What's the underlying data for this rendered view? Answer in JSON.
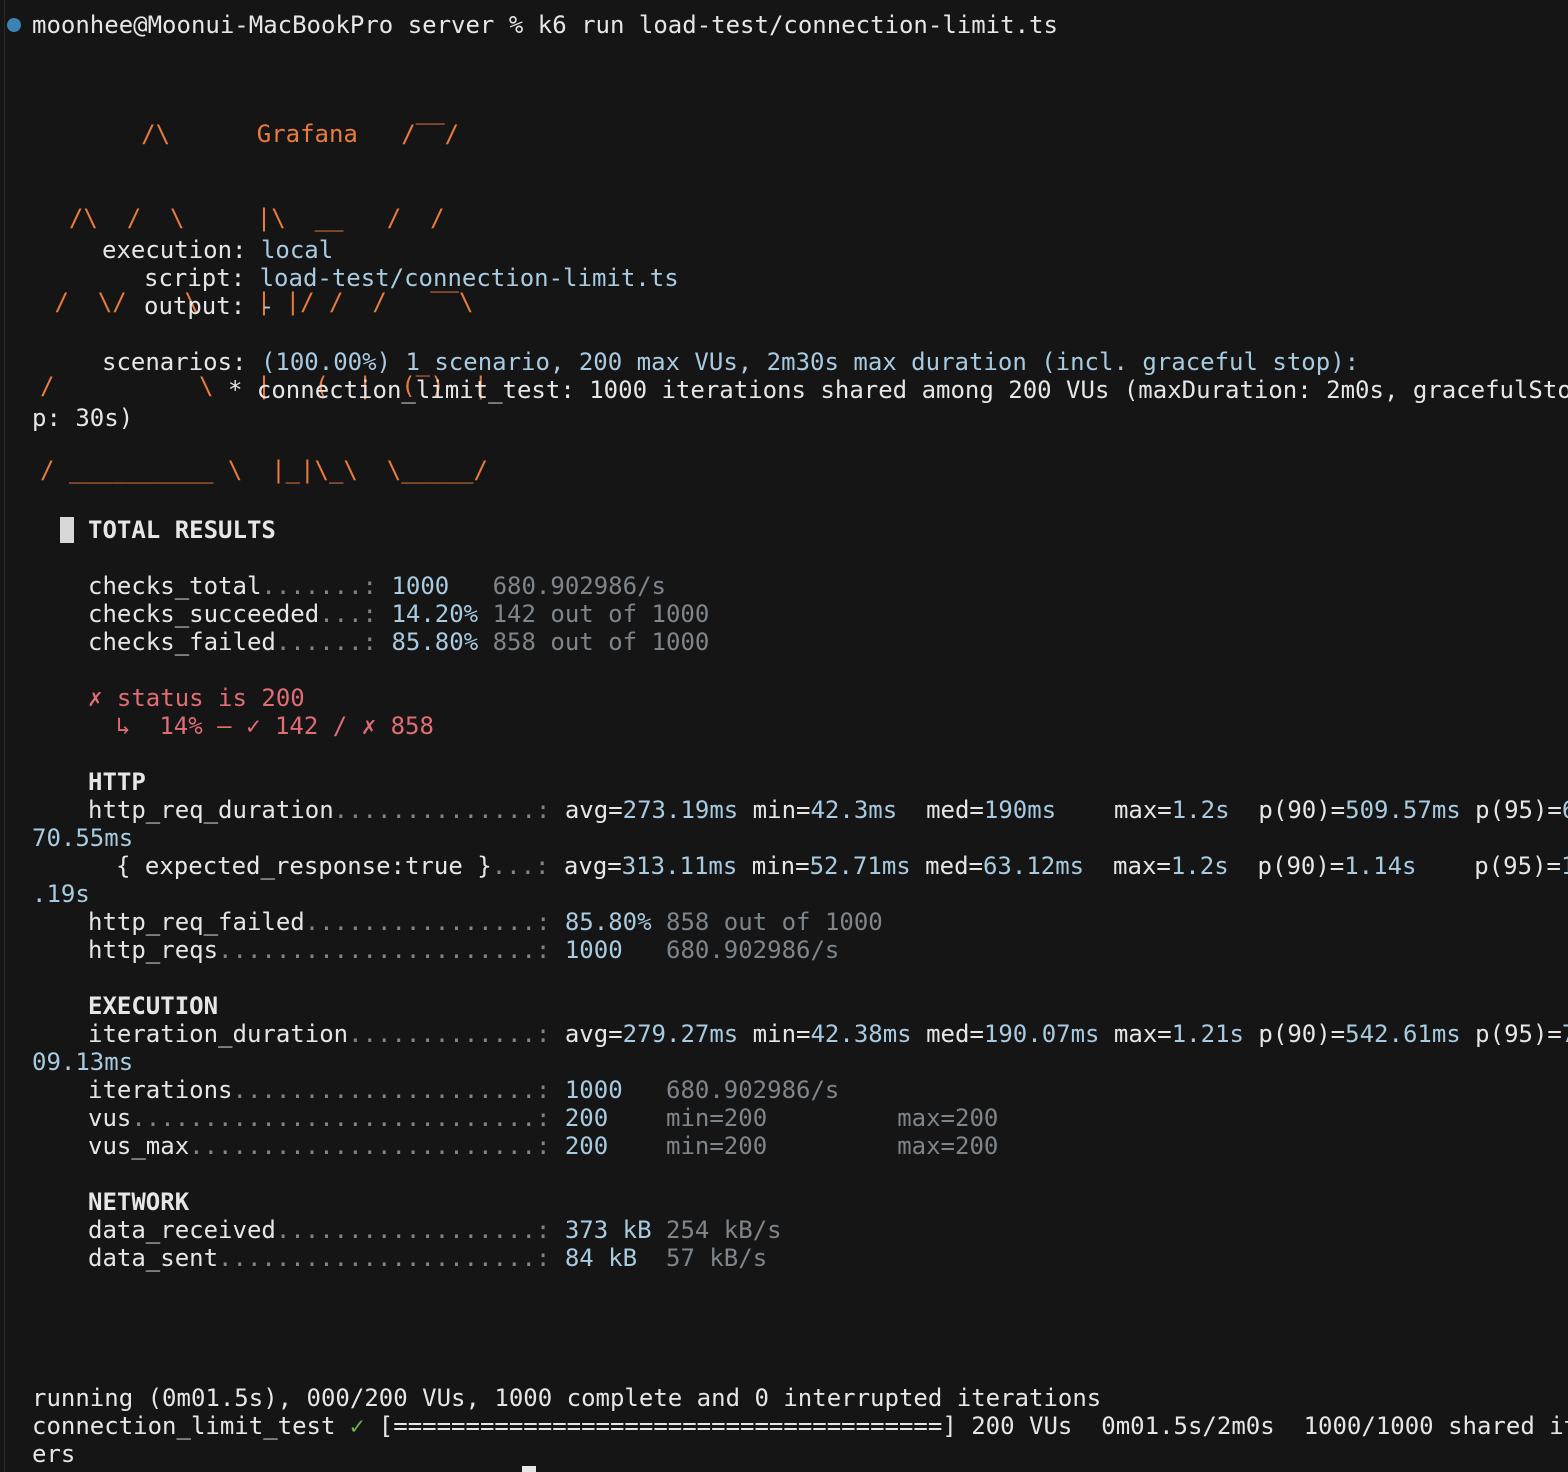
{
  "prompt": {
    "user": "moonhee@Moonui-MacBookPro",
    "dir": "server",
    "symbol": "%",
    "command": "k6 run load-test/connection-limit.ts"
  },
  "logo_art": [
    "       /\\      Grafana   /‾‾/",
    "  /\\  /  \\     |\\  __   /  /",
    " /  \\/    \\    | |/ /  /   ‾‾\\",
    "/          \\   |   (  |  (‾)  |",
    "/ __________ \\  |_|\\_\\  \\_____/"
  ],
  "execution": {
    "execution_label": "execution:",
    "execution_value": "local",
    "script_label": "script:",
    "script_value": "load-test/connection-limit.ts",
    "output_label": "output:",
    "output_value": "-",
    "scenarios_label": "scenarios:",
    "scenarios_value": "(100.00%) 1 scenario, 200 max VUs, 2m30s max duration (incl. graceful stop):",
    "scenario_line1": "* connection_limit_test: 1000 iterations shared among 200 VUs (maxDuration: 2m0s, gracefulSto",
    "scenario_line2": "p: 30s)"
  },
  "total_results": {
    "title": "TOTAL RESULTS"
  },
  "checks": [
    {
      "name": "checks_total",
      "dots": ".......:",
      "value": "1000",
      "extra": "   680.902986/s"
    },
    {
      "name": "checks_succeeded",
      "dots": "...:",
      "value": "14.20%",
      "extra": " 142 out of 1000"
    },
    {
      "name": "checks_failed",
      "dots": "......:",
      "value": "85.80%",
      "extra": " 858 out of 1000"
    }
  ],
  "status_check": {
    "line1": "✗ status is 200",
    "arrow": "↳",
    "pct": "14%",
    "sep": "—",
    "ok": "✓ 142",
    "slash": "/",
    "fail": "✗ 858"
  },
  "http": {
    "title": "HTTP",
    "req_duration": {
      "name": "http_req_duration",
      "dots": "..............:",
      "avg": "273.19ms",
      "min": "42.3ms",
      "med": "190ms",
      "max": "1.2s",
      "p90": "509.57ms",
      "p95_a": "6",
      "p95_b": "70.55ms"
    },
    "expected": {
      "name": "{ expected_response:true }",
      "dots": "...:",
      "avg": "313.11ms",
      "min": "52.71ms",
      "med": "63.12ms",
      "max": "1.2s",
      "p90": "1.14s",
      "p95_a": "1",
      "p95_b": ".19s"
    },
    "req_failed": {
      "name": "http_req_failed",
      "dots": "................:",
      "value": "85.80%",
      "extra": " 858 out of 1000"
    },
    "reqs": {
      "name": "http_reqs",
      "dots": "......................:",
      "value": "1000",
      "extra": "   680.902986/s"
    }
  },
  "execution_section": {
    "title": "EXECUTION",
    "iteration_duration": {
      "name": "iteration_duration",
      "dots": ".............:",
      "avg": "279.27ms",
      "min": "42.38ms",
      "med": "190.07ms",
      "max": "1.21s",
      "p90": "542.61ms",
      "p95_a": "7",
      "p95_b": "09.13ms"
    },
    "iterations": {
      "name": "iterations",
      "dots": ".....................:",
      "value": "1000",
      "extra": "   680.902986/s"
    },
    "vus": {
      "name": "vus",
      "dots": "............................:",
      "value": "200",
      "min": "min=200",
      "max": "max=200"
    },
    "vus_max": {
      "name": "vus_max",
      "dots": "........................:",
      "value": "200",
      "min": "min=200",
      "max": "max=200"
    }
  },
  "network": {
    "title": "NETWORK",
    "received": {
      "name": "data_received",
      "dots": "..................:",
      "value": "373 kB",
      "extra": " 254 kB/s"
    },
    "sent": {
      "name": "data_sent",
      "dots": "......................:",
      "value": "84 kB",
      "extra": "  57 kB/s"
    }
  },
  "status_bar": {
    "running": "running (0m01.5s), 000/200 VUs, 1000 complete and 0 interrupted iterations",
    "scenario_name": "connection_limit_test",
    "check": "✓",
    "progress": "[======================================]",
    "progress_fraction": 1.0,
    "vus": "200 VUs",
    "elapsed": "0m01.5s/2m0s",
    "iters": "1000/1000 shared it",
    "iters_wrap": "ers"
  }
}
